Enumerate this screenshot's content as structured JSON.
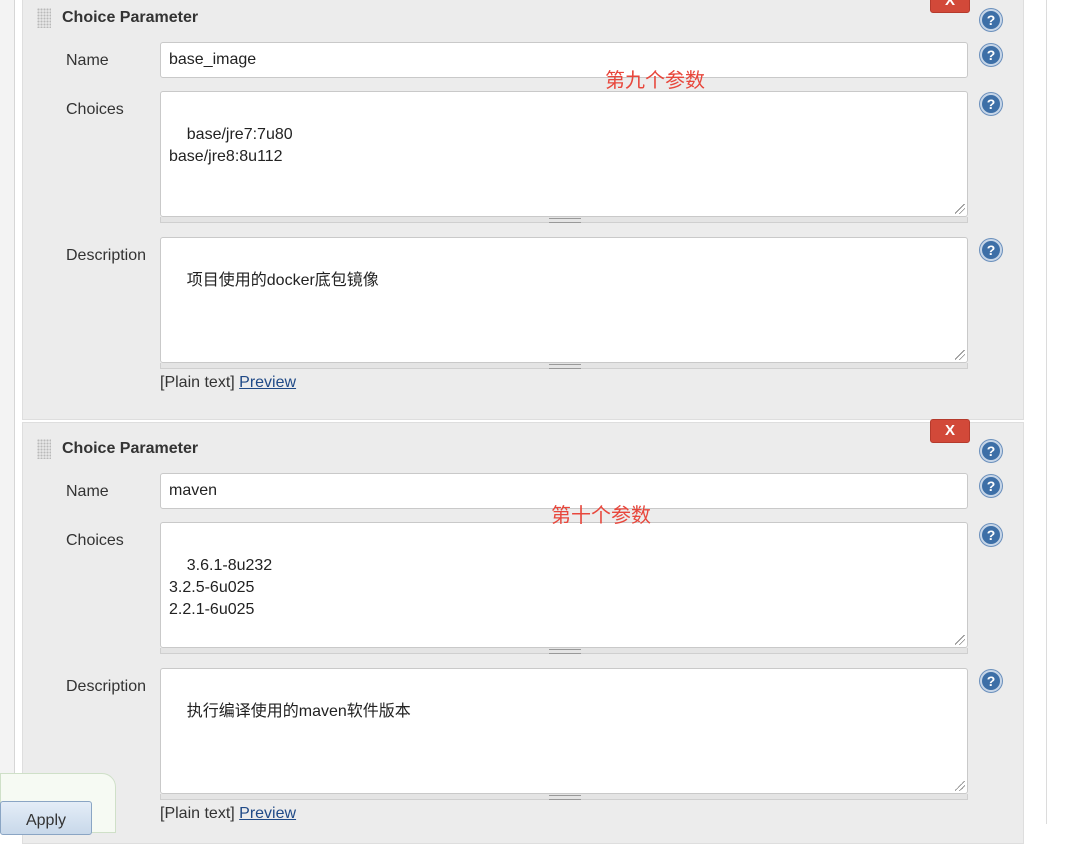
{
  "parameters": [
    {
      "title": "Choice Parameter",
      "delete_label": "X",
      "name_label": "Name",
      "name_value": "base_image",
      "choices_label": "Choices",
      "choices_value": "base/jre7:7u80\nbase/jre8:8u112",
      "description_label": "Description",
      "description_value": "项目使用的docker底包镜像",
      "format_plain": "[Plain text]",
      "format_preview": "Preview",
      "annotation": "第九个参数"
    },
    {
      "title": "Choice Parameter",
      "delete_label": "X",
      "name_label": "Name",
      "name_value": "maven",
      "choices_label": "Choices",
      "choices_value": "3.6.1-8u232\n3.2.5-6u025\n2.2.1-6u025",
      "description_label": "Description",
      "description_value": "执行编译使用的maven软件版本",
      "format_plain": "[Plain text]",
      "format_preview": "Preview",
      "annotation": "第十个参数"
    }
  ],
  "help_label": "?",
  "apply_label": "Apply",
  "colors": {
    "delete_button": "#d24939",
    "help_icon": "#3d6fa7",
    "annotation": "#e8473c",
    "link": "#204a87",
    "section_background": "#ececec"
  },
  "icons": [
    "drag-handle-icon",
    "help-icon",
    "resize-grip-icon"
  ]
}
